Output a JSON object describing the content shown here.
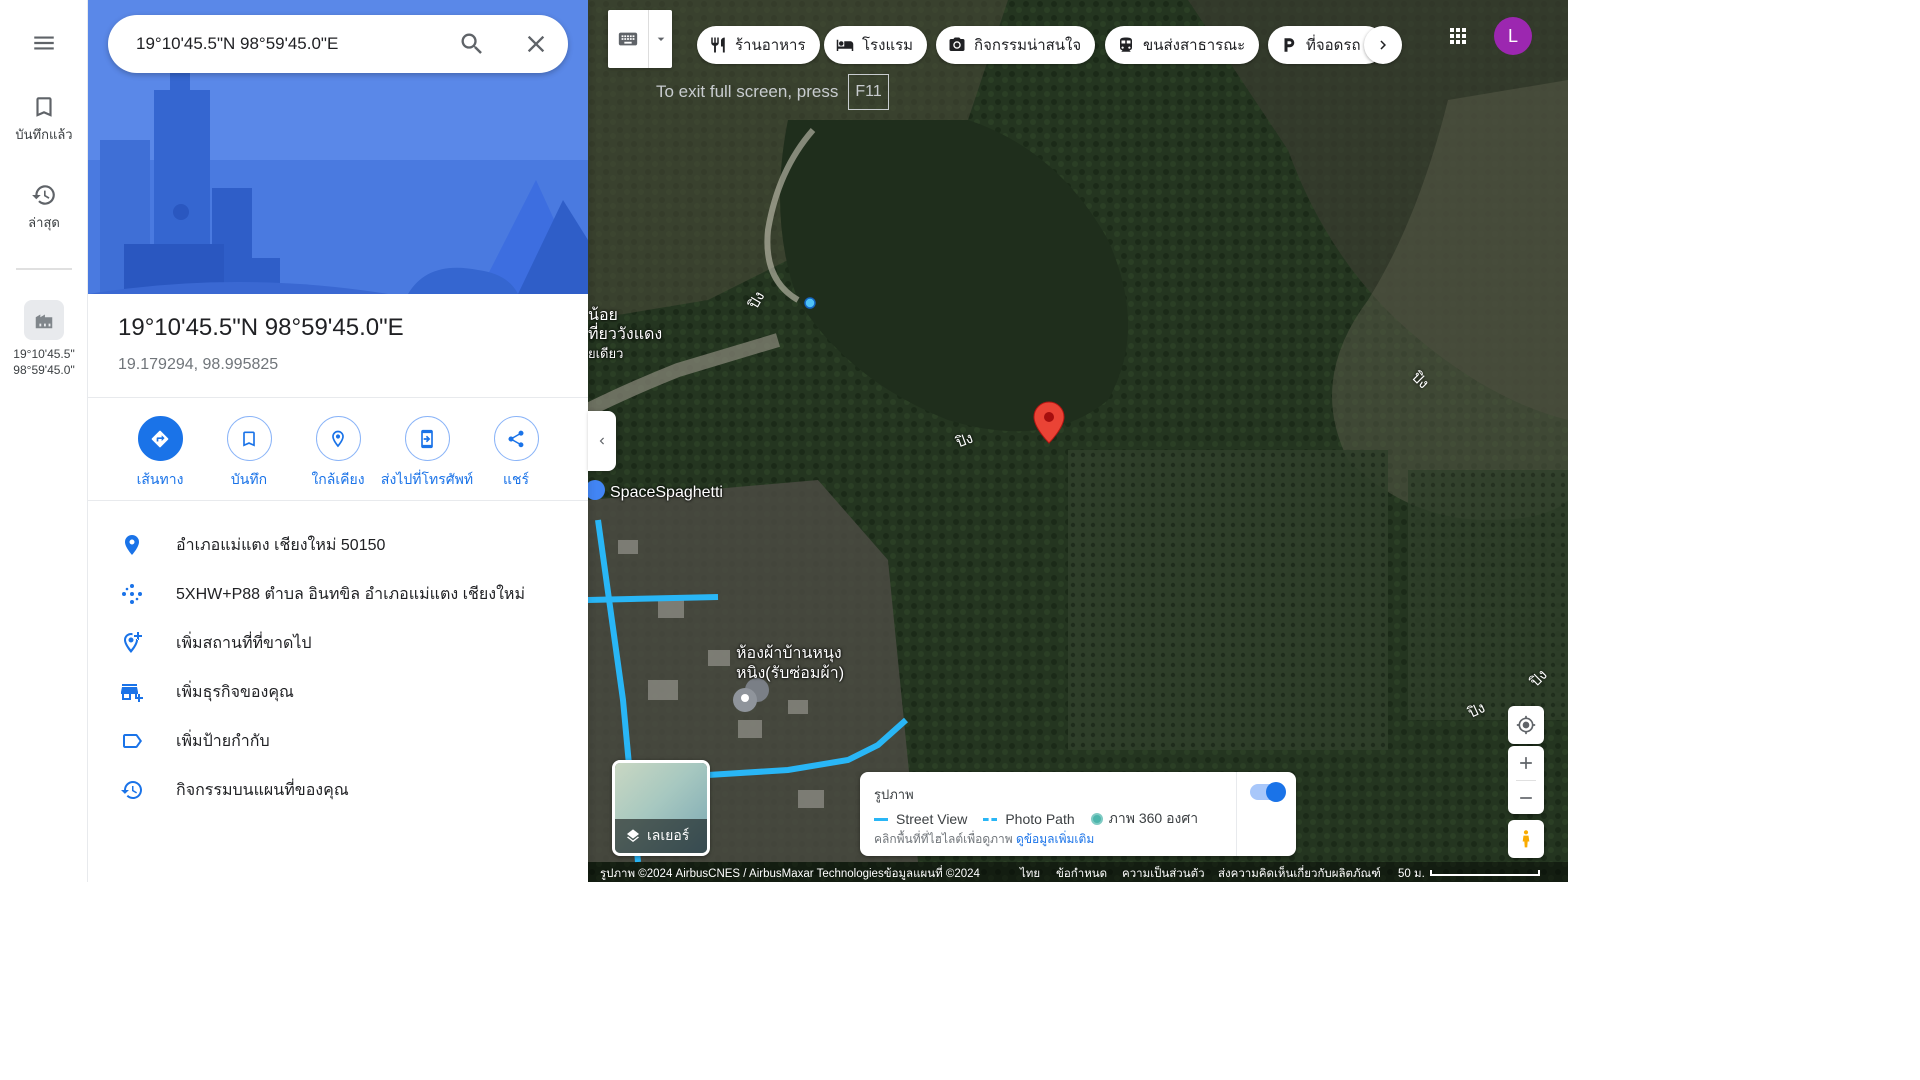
{
  "rail": {
    "saved_label": "บันทึกแล้ว",
    "recent_label": "ล่าสุด",
    "recent_place_line1": "19°10'45.5\"",
    "recent_place_line2": "98°59'45.0\""
  },
  "search": {
    "value": "19°10'45.5\"N 98°59'45.0\"E"
  },
  "place": {
    "title": "19°10'45.5\"N 98°59'45.0\"E",
    "coords": "19.179294, 98.995825"
  },
  "actions": {
    "directions": "เส้นทาง",
    "save": "บันทึก",
    "nearby": "ใกล้เคียง",
    "send_to_phone": "ส่งไปที่โทรศัพท์",
    "share": "แชร์"
  },
  "info": {
    "address": "อำเภอแม่แตง เชียงใหม่ 50150",
    "plus_code": "5XHW+P88 ตำบล อินทขิล อำเภอแม่แตง เชียงใหม่",
    "add_missing": "เพิ่มสถานที่ที่ขาดไป",
    "add_business": "เพิ่มธุรกิจของคุณ",
    "add_label": "เพิ่มป้ายกำกับ",
    "activity": "กิจกรรมบนแผนที่ของคุณ"
  },
  "chips": {
    "restaurants": "ร้านอาหาร",
    "hotels": "โรงแรม",
    "attractions": "กิจกรรมน่าสนใจ",
    "transit": "ขนส่งสาธารณะ",
    "parking": "ที่จอดรถ"
  },
  "user": {
    "initial": "L",
    "avatar_color": "#9c27b0"
  },
  "fullscreen": {
    "hint": "To exit full screen, press",
    "key": "F11"
  },
  "map_labels": {
    "poi_left_line1": "น้อย",
    "poi_left_line2": "ที่ยววังแดง",
    "poi_left_line3": "ยเดียว",
    "space": "SpaceSpaghetti",
    "shop_line1": "ห้องผ้าบ้านหนุง",
    "shop_line2": "หนิง(รับซ่อมผ้า)",
    "river": "ปิง"
  },
  "layers": {
    "label": "เลเยอร์"
  },
  "legend": {
    "title": "รูปภาพ",
    "street_view": "Street View",
    "photo_path": "Photo Path",
    "photo_360": "ภาพ 360 องศา",
    "note": "คลิกพื้นที่ที่ไฮไลต์เพื่อดูภาพ",
    "more_link": "ดูข้อมูลเพิ่มเติม"
  },
  "footer": {
    "imagery": "รูปภาพ ©2024 AirbusCNES / AirbusMaxar Technologiesข้อมูลแผนที่ ©2024",
    "language": "ไทย",
    "terms": "ข้อกำหนด",
    "privacy": "ความเป็นส่วนตัว",
    "feedback": "ส่งความคิดเห็นเกี่ยวกับผลิตภัณฑ์",
    "scale": "50 ม."
  },
  "colors": {
    "accent": "#1a73e8",
    "pin": "#ea4335",
    "route": "#29b6f6"
  }
}
